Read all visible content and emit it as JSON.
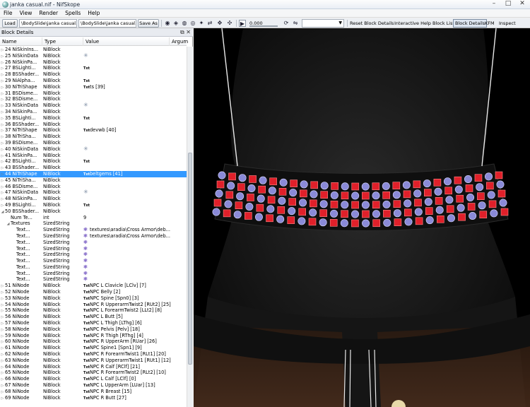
{
  "window": {
    "title": "janka casual.nif - NifSkope"
  },
  "window_controls": {
    "minimize": "–",
    "maximize": "□",
    "close": "✕"
  },
  "menu": [
    "File",
    "View",
    "Render",
    "Spells",
    "Help"
  ],
  "toolbar": {
    "load_label": "Load",
    "load_path": "\\BodySlide\\janka casual.nif",
    "save_path": "\\BodySlide\\janka casual.nif",
    "save_as_label": "Save As",
    "time_value": "0.000",
    "reset_label": "Reset Block Details",
    "help_label": "Interactive Help",
    "blocklist_label": "Block List",
    "blockdetails_label": "Block Details",
    "kfm_label": "KFM",
    "inspect_label": "Inspect"
  },
  "panel": {
    "title": "Block Details",
    "columns": {
      "name": "Name",
      "type": "Type",
      "value": "Value",
      "args": "Argum"
    }
  },
  "rows": [
    {
      "name": "24 NiSkinIns...",
      "type": "NiBlock",
      "icon": "",
      "value": ""
    },
    {
      "name": "25 NiSkinData",
      "type": "NiBlock",
      "icon": "cross",
      "value": ""
    },
    {
      "name": "26 NiSkinPa...",
      "type": "NiBlock",
      "icon": "",
      "value": ""
    },
    {
      "name": "27 BSLighti...",
      "type": "NiBlock",
      "icon": "txt",
      "value": ""
    },
    {
      "name": "28 BSShader...",
      "type": "NiBlock",
      "icon": "",
      "value": ""
    },
    {
      "name": "29 NiAlpha...",
      "type": "NiBlock",
      "icon": "txt",
      "value": ""
    },
    {
      "name": "30 NiTriShape",
      "type": "NiBlock",
      "icon": "txt",
      "value": "ts [39]"
    },
    {
      "name": "31 BSDisme...",
      "type": "NiBlock",
      "icon": "",
      "value": ""
    },
    {
      "name": "32 BSDisme...",
      "type": "NiBlock",
      "icon": "",
      "value": ""
    },
    {
      "name": "33 NiSkinData",
      "type": "NiBlock",
      "icon": "cross",
      "value": ""
    },
    {
      "name": "34 NiSkinPa...",
      "type": "NiBlock",
      "icon": "",
      "value": ""
    },
    {
      "name": "35 BSLighti...",
      "type": "NiBlock",
      "icon": "txt",
      "value": ""
    },
    {
      "name": "36 BSShader...",
      "type": "NiBlock",
      "icon": "",
      "value": ""
    },
    {
      "name": "37 NiTriShape",
      "type": "NiBlock",
      "icon": "txt",
      "value": "devwb [40]"
    },
    {
      "name": "38 NiTriSha...",
      "type": "NiBlock",
      "icon": "",
      "value": ""
    },
    {
      "name": "39 BSDisme...",
      "type": "NiBlock",
      "icon": "",
      "value": ""
    },
    {
      "name": "40 NiSkinData",
      "type": "NiBlock",
      "icon": "cross",
      "value": ""
    },
    {
      "name": "41 NiSkinPa...",
      "type": "NiBlock",
      "icon": "",
      "value": ""
    },
    {
      "name": "42 BSLighti...",
      "type": "NiBlock",
      "icon": "txt",
      "value": ""
    },
    {
      "name": "43 BSShader...",
      "type": "NiBlock",
      "icon": "",
      "value": ""
    },
    {
      "name": "44 NiTriShape",
      "type": "NiBlock",
      "icon": "txt",
      "value": "beltgems [41]",
      "selected": true
    },
    {
      "name": "45 NiTriSha...",
      "type": "NiBlock",
      "icon": "",
      "value": ""
    },
    {
      "name": "46 BSDisme...",
      "type": "NiBlock",
      "icon": "",
      "value": ""
    },
    {
      "name": "47 NiSkinData",
      "type": "NiBlock",
      "icon": "cross",
      "value": ""
    },
    {
      "name": "48 NiSkinPa...",
      "type": "NiBlock",
      "icon": "",
      "value": ""
    },
    {
      "name": "49 BSLighti...",
      "type": "NiBlock",
      "icon": "txt",
      "value": ""
    },
    {
      "name": "50 BSShader...",
      "type": "NiBlock",
      "icon": "",
      "value": "",
      "expanded": true
    },
    {
      "name": "Num Te...",
      "type": "int",
      "icon": "",
      "value": "9",
      "child": 1
    },
    {
      "name": "Textures",
      "type": "SizedString",
      "icon": "",
      "value": "",
      "child": 1,
      "expanded": true
    },
    {
      "name": "Text...",
      "type": "SizedString",
      "icon": "star",
      "value": "textures\\aradia\\Cross Armor\\deb...",
      "child": 2
    },
    {
      "name": "Text...",
      "type": "SizedString",
      "icon": "star",
      "value": "textures\\aradia\\Cross Armor\\deb...",
      "child": 2
    },
    {
      "name": "Text...",
      "type": "SizedString",
      "icon": "star",
      "value": "",
      "child": 2
    },
    {
      "name": "Text...",
      "type": "SizedString",
      "icon": "star",
      "value": "",
      "child": 2
    },
    {
      "name": "Text...",
      "type": "SizedString",
      "icon": "star",
      "value": "",
      "child": 2
    },
    {
      "name": "Text...",
      "type": "SizedString",
      "icon": "star",
      "value": "",
      "child": 2
    },
    {
      "name": "Text...",
      "type": "SizedString",
      "icon": "star",
      "value": "",
      "child": 2
    },
    {
      "name": "Text...",
      "type": "SizedString",
      "icon": "star",
      "value": "",
      "child": 2
    },
    {
      "name": "Text...",
      "type": "SizedString",
      "icon": "star",
      "value": "",
      "child": 2
    },
    {
      "name": "51 NiNode",
      "type": "NiBlock",
      "icon": "txt",
      "value": "NPC L Clavicle [LClv] [7]"
    },
    {
      "name": "52 NiNode",
      "type": "NiBlock",
      "icon": "txt",
      "value": "NPC Belly [2]"
    },
    {
      "name": "53 NiNode",
      "type": "NiBlock",
      "icon": "txt",
      "value": "NPC Spine [Spn0] [3]"
    },
    {
      "name": "54 NiNode",
      "type": "NiBlock",
      "icon": "txt",
      "value": "NPC R UpperarmTwist2 [RUt2] [25]"
    },
    {
      "name": "55 NiNode",
      "type": "NiBlock",
      "icon": "txt",
      "value": "NPC L ForearmTwist2 [LLt2] [8]"
    },
    {
      "name": "56 NiNode",
      "type": "NiBlock",
      "icon": "txt",
      "value": "NPC L Butt [5]"
    },
    {
      "name": "57 NiNode",
      "type": "NiBlock",
      "icon": "txt",
      "value": "NPC L Thigh [LThg] [6]"
    },
    {
      "name": "58 NiNode",
      "type": "NiBlock",
      "icon": "txt",
      "value": "NPC Pelvis [Pelv] [18]"
    },
    {
      "name": "59 NiNode",
      "type": "NiBlock",
      "icon": "txt",
      "value": "NPC R Thigh [RThg] [4]"
    },
    {
      "name": "60 NiNode",
      "type": "NiBlock",
      "icon": "txt",
      "value": "NPC R UpperArm [RUar] [26]"
    },
    {
      "name": "61 NiNode",
      "type": "NiBlock",
      "icon": "txt",
      "value": "NPC Spine1 [Spn1] [9]"
    },
    {
      "name": "62 NiNode",
      "type": "NiBlock",
      "icon": "txt",
      "value": "NPC R ForearmTwist1 [RLt1] [20]"
    },
    {
      "name": "63 NiNode",
      "type": "NiBlock",
      "icon": "txt",
      "value": "NPC R UpperarmTwist1 [RUt1] [12]"
    },
    {
      "name": "64 NiNode",
      "type": "NiBlock",
      "icon": "txt",
      "value": "NPC R Calf [RClf] [21]"
    },
    {
      "name": "65 NiNode",
      "type": "NiBlock",
      "icon": "txt",
      "value": "NPC R ForearmTwist2 [RLt2] [10]"
    },
    {
      "name": "66 NiNode",
      "type": "NiBlock",
      "icon": "txt",
      "value": "NPC L Calf [LClf] [0]"
    },
    {
      "name": "67 NiNode",
      "type": "NiBlock",
      "icon": "txt",
      "value": "NPC L UpperArm [LUar] [13]"
    },
    {
      "name": "68 NiNode",
      "type": "NiBlock",
      "icon": "txt",
      "value": "NPC R Breast [15]"
    },
    {
      "name": "69 NiNode",
      "type": "NiBlock",
      "icon": "txt",
      "value": "NPC R Butt [27]"
    }
  ],
  "icons": {
    "txt_label": "Txt",
    "cross_glyph": "✳",
    "star_glyph": "❃"
  },
  "colors": {
    "selection": "#3399ff",
    "gem_red": "#e0202a",
    "gem_blue": "#8a8ad8",
    "cloth": "#1c1c1c",
    "skin": "#3a2318"
  }
}
